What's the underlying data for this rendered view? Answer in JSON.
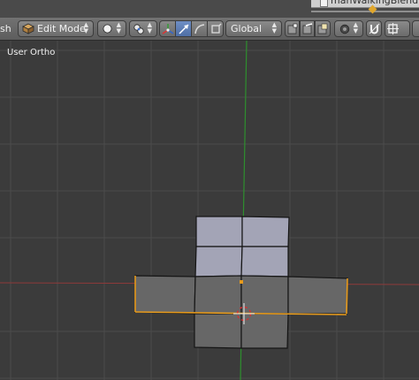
{
  "title_bar": {
    "filename": "manWalkingBlend"
  },
  "header": {
    "menu_fragment": "sh",
    "mode": {
      "label": "Edit Mode"
    },
    "orientation": {
      "label": "Global"
    }
  },
  "viewport": {
    "view_label": "User Ortho"
  },
  "colors": {
    "viewport_bg": "#3b3b3b",
    "grid": "#4b4b4b",
    "x_axis": "#8e3a3a",
    "y_axis": "#2e8f2e",
    "selected_face": "#a3a4b6",
    "unselected_face": "#676767",
    "selected_edge": "#e69a1c",
    "active_button": "#5577b0"
  },
  "icons": {
    "mode_icon": "mesh-cube-icon",
    "shading_icon": "solid-sphere-icon",
    "pivot_icon": "pivot-point-icon",
    "manipulator_icons": [
      "transform-axes-icon",
      "translate-arrow-icon",
      "rotate-arc-icon",
      "scale-box-icon"
    ],
    "select_mode_icons": [
      "vertex-select-icon",
      "edge-select-icon",
      "face-select-icon"
    ],
    "proportional_icon": "proportional-edit-icon",
    "snap_icons": [
      "snap-magnet-icon",
      "snap-target-icon"
    ]
  }
}
